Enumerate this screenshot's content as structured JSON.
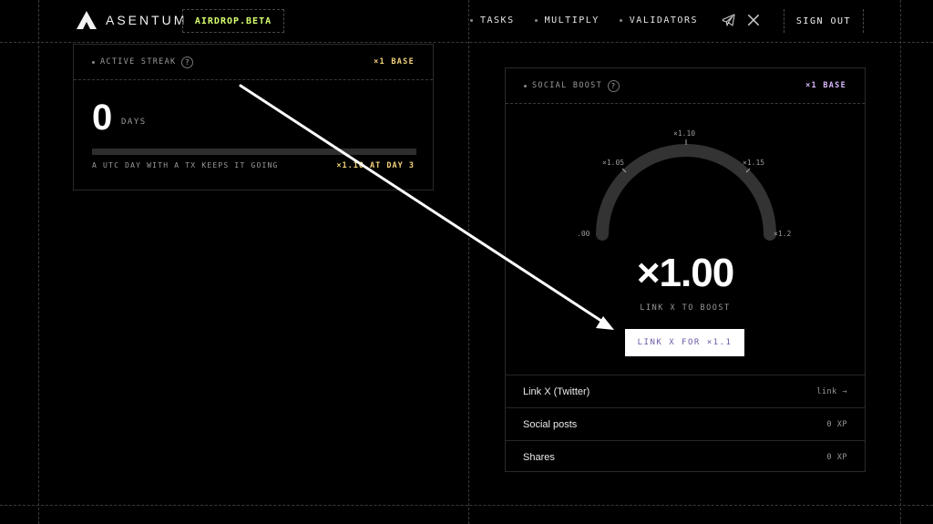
{
  "header": {
    "logo_text": "ASENTUM",
    "badge": "AIRDROP.BETA",
    "nav": [
      "TASKS",
      "MULTIPLY",
      "VALIDATORS"
    ],
    "sign_out": "SIGN OUT"
  },
  "streak_card": {
    "title": "ACTIVE STREAK",
    "base": "×1 BASE",
    "count": "0",
    "unit": "DAYS",
    "caption": "A UTC DAY WITH A TX KEEPS IT GOING",
    "goal": "×1.10 AT DAY 3",
    "progress": 0
  },
  "boost_card": {
    "title": "SOCIAL BOOST",
    "base": "×1 BASE",
    "gauge_ticks": [
      ".00",
      "×1.05",
      "×1.10",
      "×1.15",
      "×1.2"
    ],
    "multiplier": "×1.00",
    "subtitle": "LINK X TO BOOST",
    "button": "LINK X FOR ×1.1",
    "rows": [
      {
        "label": "Link X (Twitter)",
        "value": "link →"
      },
      {
        "label": "Social posts",
        "value": "0 XP"
      },
      {
        "label": "Shares",
        "value": "0 XP"
      }
    ]
  },
  "colors": {
    "background": "#000000",
    "accent_lime": "#d7ff6e",
    "accent_yellow": "#f2d27b",
    "accent_purple": "#d9b8ff"
  },
  "icons": [
    "asentum-logo-icon",
    "telegram-icon",
    "x-icon",
    "question-icon"
  ]
}
